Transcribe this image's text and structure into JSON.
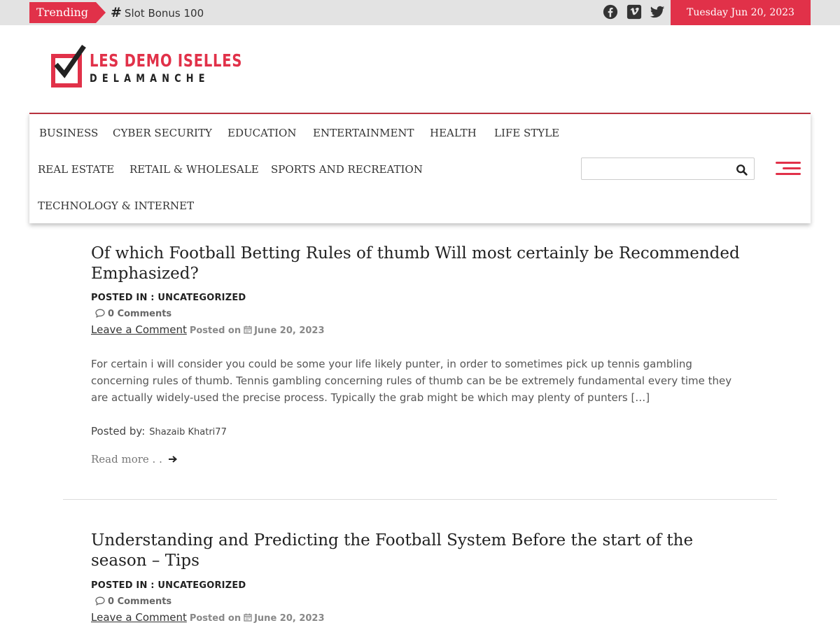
{
  "topbar": {
    "trending_label": "Trending",
    "trending_item": "Slot Bonus 100",
    "date": "Tuesday Jun 20, 2023",
    "social_icons": [
      "facebook-icon",
      "vimeo-icon",
      "twitter-icon"
    ],
    "accent_color": "#e13149"
  },
  "logo": {
    "line1": "LES DEMO ISELLES",
    "line2": "DELAMANCHE"
  },
  "nav": {
    "items": [
      "BUSINESS",
      "CYBER SECURITY",
      "EDUCATION",
      "ENTERTAINMENT",
      "HEALTH",
      "LIFE STYLE",
      "REAL ESTATE",
      "RETAIL & WHOLESALE",
      "SPORTS AND RECREATION",
      "TECHNOLOGY & INTERNET"
    ],
    "search_value": ""
  },
  "posts": [
    {
      "title": "Of which Football Betting Rules of thumb Will most certainly be Recommended Emphasized?",
      "posted_in": "POSTED IN : UNCATEGORIZED",
      "comments": "0 Comments",
      "leave_comment": "Leave a Comment",
      "posted_on": "Posted on",
      "date": "June 20, 2023",
      "excerpt": "For certain i will consider you could be some your life likely punter, in order to sometimes pick up tennis gambling concerning rules of thumb. Tennis gambling concerning rules of thumb can be be extremely fundamental every time they are actually widely-used the precise process. Typically the grab might be which may plenty of punters […]",
      "posted_by_label": "Posted by:",
      "author": "Shazaib Khatri77",
      "read_more": "Read more . ."
    },
    {
      "title": "Understanding and Predicting the Football System Before the start of the season – Tips",
      "posted_in": "POSTED IN : UNCATEGORIZED",
      "comments": "0 Comments",
      "leave_comment": "Leave a Comment",
      "posted_on": "Posted on",
      "date": "June 20, 2023"
    }
  ]
}
